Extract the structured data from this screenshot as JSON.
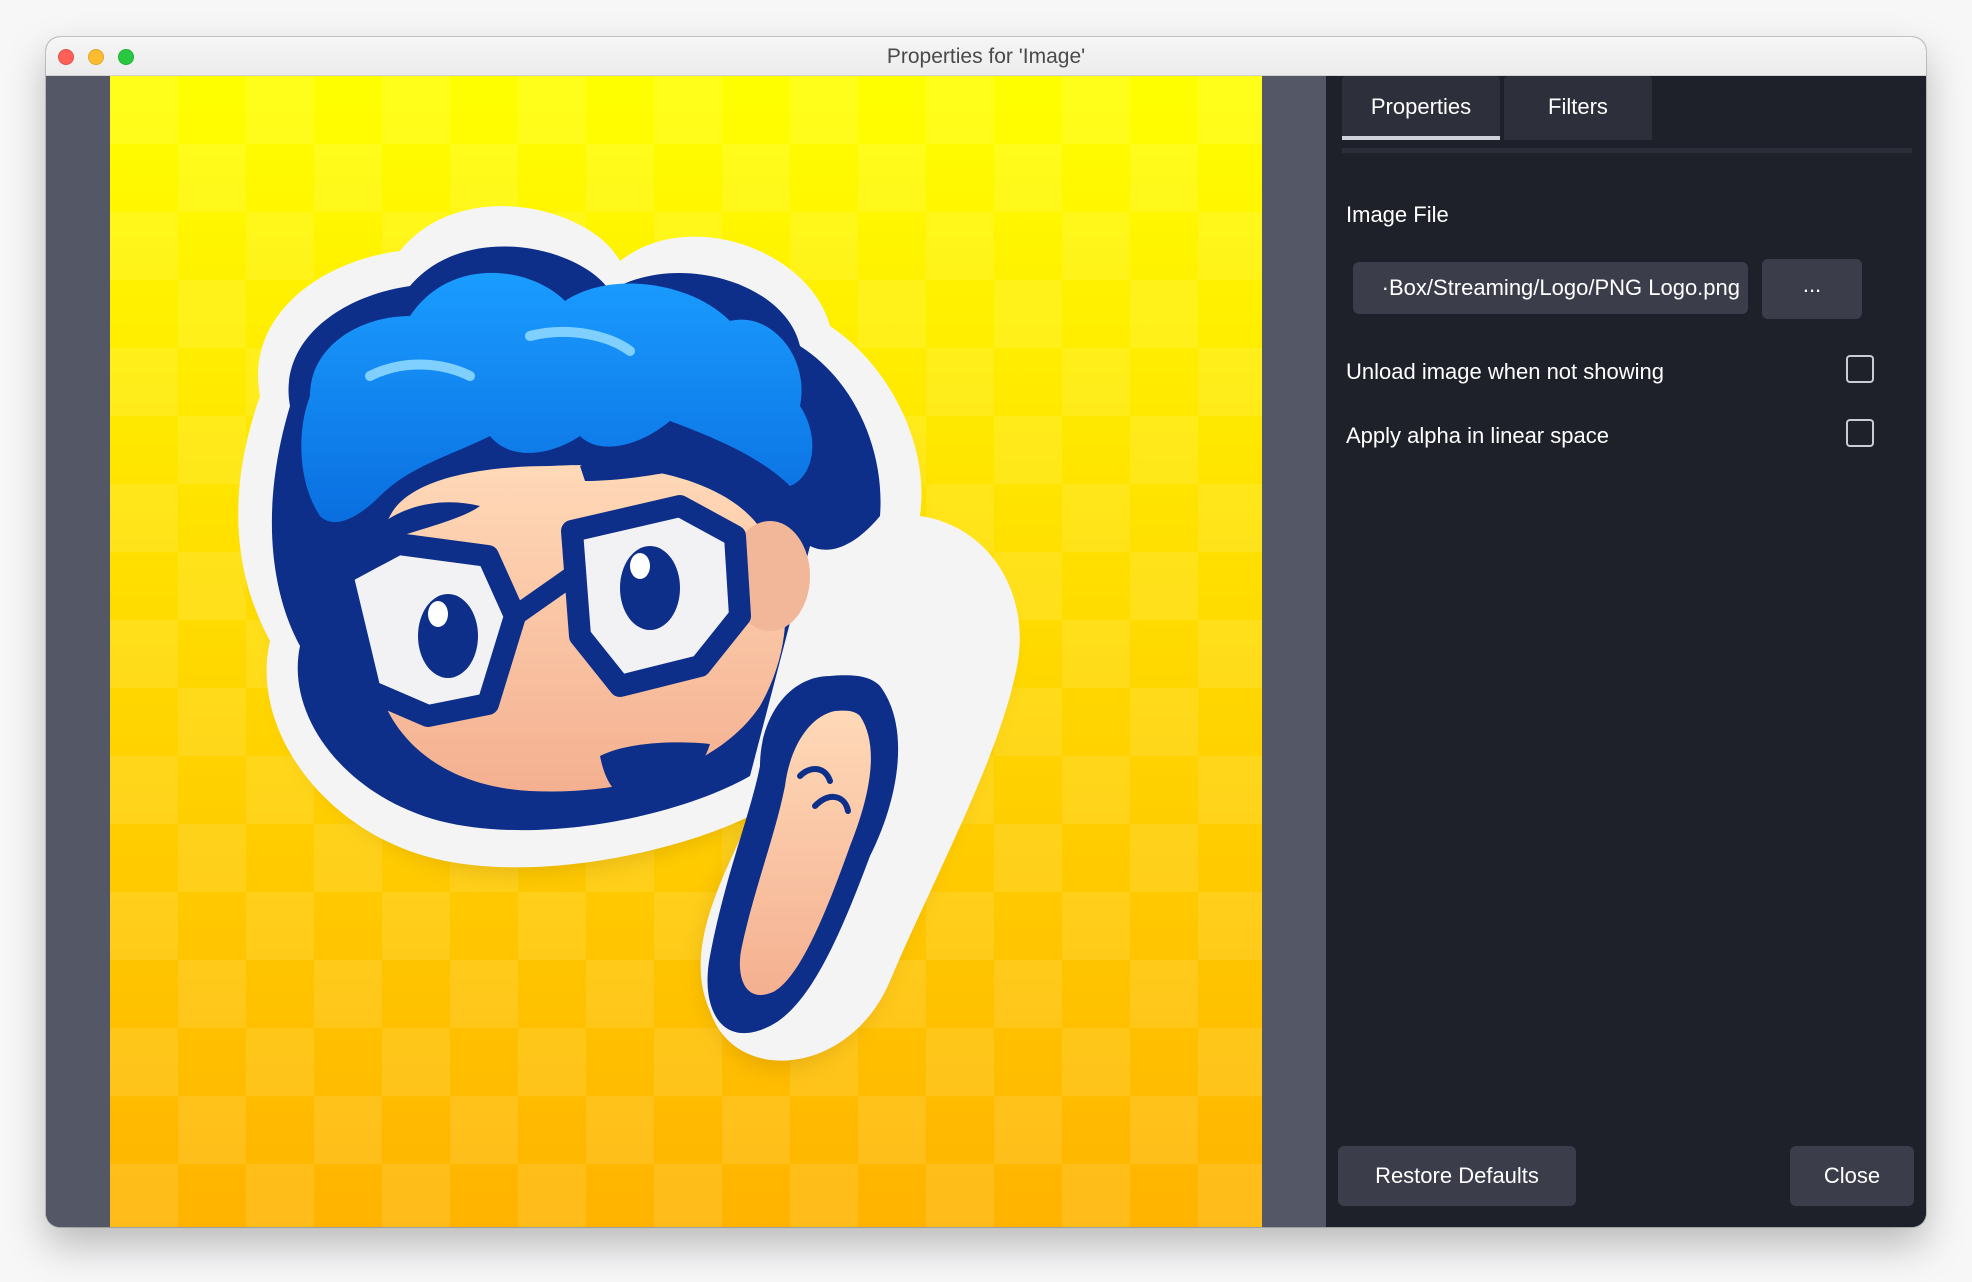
{
  "window": {
    "title": "Properties for 'Image'"
  },
  "tabs": [
    {
      "label": "Properties",
      "active": true
    },
    {
      "label": "Filters",
      "active": false
    }
  ],
  "image_file": {
    "label": "Image File",
    "value": "·Box/Streaming/Logo/PNG Logo.png",
    "browse_label": "..."
  },
  "options": [
    {
      "label": "Unload image when not showing",
      "checked": false
    },
    {
      "label": "Apply alpha in linear space",
      "checked": false
    }
  ],
  "footer": {
    "restore_label": "Restore Defaults",
    "close_label": "Close"
  },
  "preview": {
    "subject": "cartoon avatar sticker with blue hair and glasses raising a fist",
    "background_colors": [
      "#ffff00",
      "#ffb300"
    ]
  },
  "colors": {
    "panel_bg": "#1f212a",
    "control_bg": "#3b3e4a",
    "preview_frame": "#545766"
  }
}
